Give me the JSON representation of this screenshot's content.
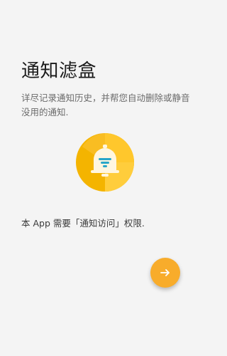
{
  "onboarding": {
    "title": "通知滤盒",
    "description": "详尽记录通知历史，并帮您自动删除或静音没用的通知.",
    "permission_note": "本 App 需要「通知访问」权限.",
    "next_icon": "arrow-right-icon",
    "logo_icon": "bell-filter-icon"
  },
  "colors": {
    "accent": "#f8ac2b",
    "logo_dark": "#f4b400",
    "logo_light": "#ffd040",
    "bell": "#fff6e0",
    "filter_lines": "#2aa7c9"
  }
}
